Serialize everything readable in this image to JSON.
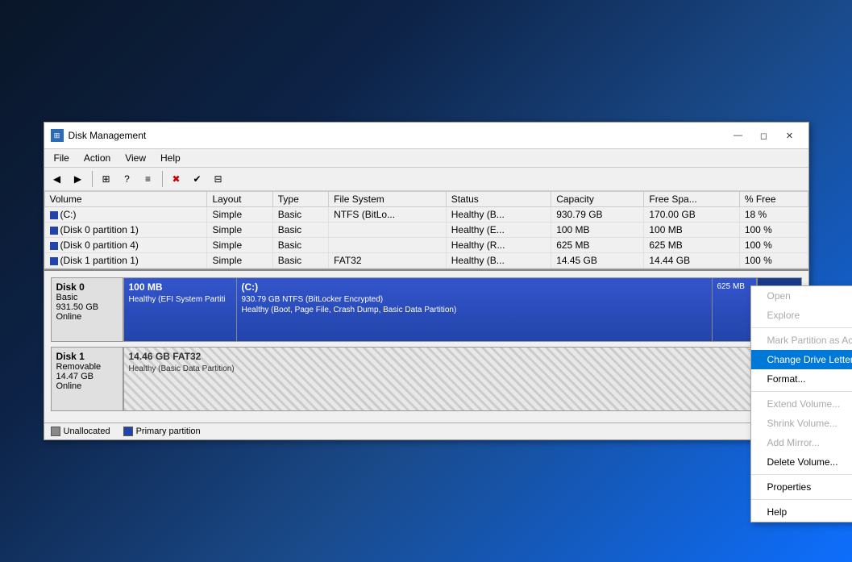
{
  "window": {
    "title": "Disk Management",
    "icon": "💾"
  },
  "menu": {
    "items": [
      "File",
      "Action",
      "View",
      "Help"
    ]
  },
  "toolbar": {
    "buttons": [
      "◀",
      "▶",
      "⊞",
      "?",
      "≡",
      "✖",
      "✔",
      "⊟"
    ]
  },
  "table": {
    "headers": [
      "Volume",
      "Layout",
      "Type",
      "File System",
      "Status",
      "Capacity",
      "Free Spa...",
      "% Free"
    ],
    "rows": [
      [
        "(C:)",
        "Simple",
        "Basic",
        "NTFS (BitLo...",
        "Healthy (B...",
        "930.79 GB",
        "170.00 GB",
        "18 %"
      ],
      [
        "(Disk 0 partition 1)",
        "Simple",
        "Basic",
        "",
        "Healthy (E...",
        "100 MB",
        "100 MB",
        "100 %"
      ],
      [
        "(Disk 0 partition 4)",
        "Simple",
        "Basic",
        "",
        "Healthy (R...",
        "625 MB",
        "625 MB",
        "100 %"
      ],
      [
        "(Disk 1 partition 1)",
        "Simple",
        "Basic",
        "FAT32",
        "Healthy (B...",
        "14.45 GB",
        "14.44 GB",
        "100 %"
      ]
    ]
  },
  "disk0": {
    "name": "Disk 0",
    "type": "Basic",
    "size": "931.50 GB",
    "status": "Online",
    "partitions": [
      {
        "label": "100 MB",
        "detail": "Healthy (EFI System Partiti"
      },
      {
        "label": "(C:)",
        "detail1": "930.79 GB NTFS (BitLocker Encrypted)",
        "detail2": "Healthy (Boot, Page File, Crash Dump, Basic Data Partition)"
      },
      {
        "label": "625 MB",
        "detail": ""
      }
    ]
  },
  "disk1": {
    "name": "Disk 1",
    "type": "Removable",
    "size": "14.47 GB",
    "status": "Online",
    "partitions": [
      {
        "label": "14.46 GB FAT32",
        "detail": "Healthy (Basic Data Partition)"
      }
    ]
  },
  "context_menu": {
    "items": [
      {
        "label": "Open",
        "disabled": true
      },
      {
        "label": "Explore",
        "disabled": true
      },
      {
        "separator": false
      },
      {
        "label": "Mark Partition as Active",
        "disabled": true
      },
      {
        "label": "Change Drive Letter and Paths...",
        "disabled": false,
        "active": true
      },
      {
        "label": "Format...",
        "disabled": false
      },
      {
        "separator_after": true
      },
      {
        "label": "Extend Volume...",
        "disabled": true
      },
      {
        "label": "Shrink Volume...",
        "disabled": true
      },
      {
        "label": "Add Mirror...",
        "disabled": true
      },
      {
        "label": "Delete Volume...",
        "disabled": false
      },
      {
        "separator_after2": true
      },
      {
        "label": "Properties",
        "disabled": false
      },
      {
        "separator_after3": true
      },
      {
        "label": "Help",
        "disabled": false
      }
    ]
  },
  "status_bar": {
    "unalloc_label": "Unallocated",
    "primary_label": "Primary partition"
  }
}
